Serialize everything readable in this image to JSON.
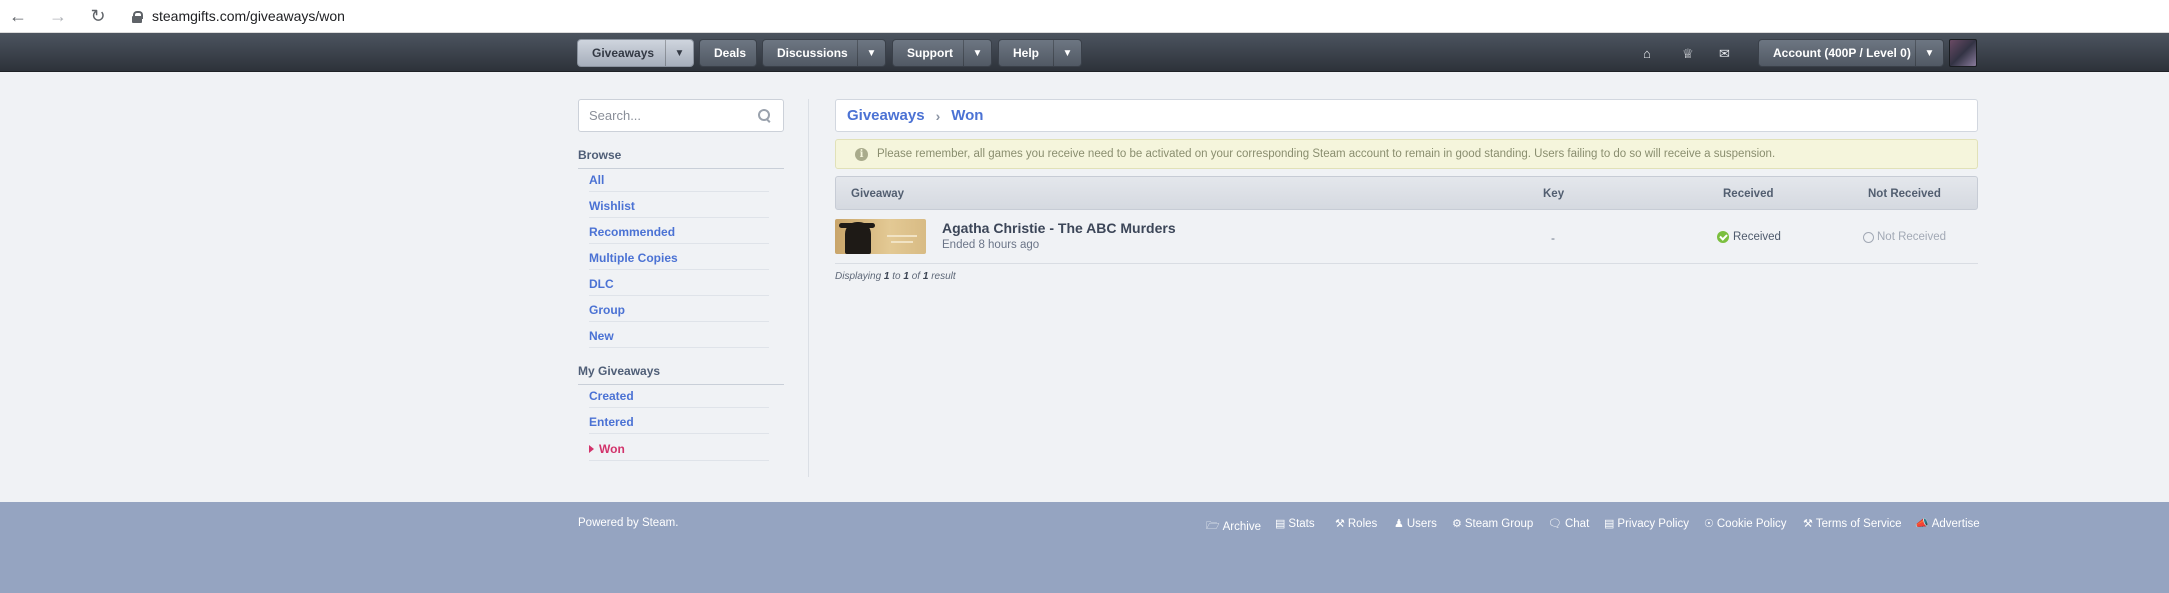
{
  "browser": {
    "url": "steamgifts.com/giveaways/won"
  },
  "header": {
    "nav": [
      {
        "label": "Giveaways",
        "active": true
      },
      {
        "label": "Deals"
      },
      {
        "label": "Discussions"
      },
      {
        "label": "Support"
      },
      {
        "label": "Help"
      }
    ],
    "account_label": "Account (400P / Level 0)",
    "icons": [
      "home-icon",
      "trophy-icon",
      "envelope-icon"
    ]
  },
  "sidebar": {
    "search_placeholder": "Search...",
    "browse_heading": "Browse",
    "browse_items": [
      "All",
      "Wishlist",
      "Recommended",
      "Multiple Copies",
      "DLC",
      "Group",
      "New"
    ],
    "my_heading": "My Giveaways",
    "my_items": [
      "Created",
      "Entered",
      "Won"
    ],
    "selected_item": "Won"
  },
  "main": {
    "breadcrumb": [
      "Giveaways",
      "Won"
    ],
    "notice": "Please remember, all games you receive need to be activated on your corresponding Steam account to remain in good standing. Users failing to do so will receive a suspension.",
    "columns": [
      "Giveaway",
      "Key",
      "Received",
      "Not Received"
    ],
    "rows": [
      {
        "title": "Agatha Christie - The ABC Murders",
        "time": "Ended 8 hours ago",
        "key": "-",
        "received": "Received",
        "not_received": "Not Received"
      }
    ],
    "pagination": {
      "prefix": "Displaying ",
      "from": "1",
      "to_word": " to ",
      "to": "1",
      "of_word": " of ",
      "total": "1",
      "suffix": " result"
    }
  },
  "footer": {
    "powered_prefix": "Powered by ",
    "powered_link": "Steam",
    "powered_suffix": ".",
    "links": [
      "Archive",
      "Stats",
      "Roles",
      "Users",
      "Steam Group",
      "Chat",
      "Privacy Policy",
      "Cookie Policy",
      "Terms of Service",
      "Advertise"
    ]
  },
  "colors": {
    "link": "#4b72d4",
    "selected": "#d2336b",
    "footer_bg": "#95a4c1",
    "header_bg": "#3a4049",
    "received_green": "#7bbf3f"
  }
}
